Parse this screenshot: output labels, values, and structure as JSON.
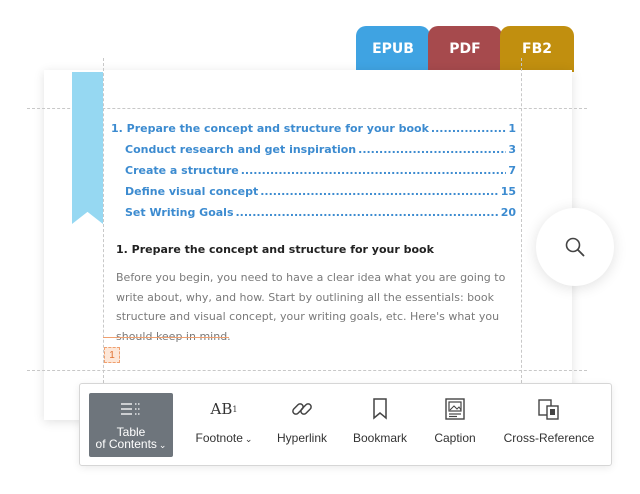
{
  "format_tabs": [
    {
      "label": "EPUB",
      "color": "#3fa3e2"
    },
    {
      "label": "PDF",
      "color": "#a64a4d"
    },
    {
      "label": "FB2",
      "color": "#c18f0f"
    }
  ],
  "toc": [
    {
      "label": "1. Prepare the concept and structure for your book",
      "page": "1",
      "level": 1
    },
    {
      "label": "Conduct research and get inspiration",
      "page": "3",
      "level": 2
    },
    {
      "label": "Create a structure",
      "page": "7",
      "level": 2
    },
    {
      "label": "Define visual concept",
      "page": "15",
      "level": 2
    },
    {
      "label": "Set Writing Goals",
      "page": "20",
      "level": 2
    }
  ],
  "section": {
    "heading": "1. Prepare the concept and structure for your book",
    "body": "Before you begin, you need to have a clear idea what you are going to write about, why, and how. Start by outlining all the essentials: book structure and visual concept, your writing goals, etc. Here's what you should keep in mind."
  },
  "footnote_marker": "1",
  "search": {
    "icon": "search-icon"
  },
  "toolbar": {
    "table_of_contents": {
      "line1": "Table",
      "line2": "of Contents",
      "icon": "toc-icon"
    },
    "footnote": {
      "label": "Footnote",
      "icon": "footnote-icon",
      "glyph": "AB",
      "sup": "1"
    },
    "hyperlink": {
      "label": "Hyperlink",
      "icon": "link-icon"
    },
    "bookmark": {
      "label": "Bookmark",
      "icon": "bookmark-icon"
    },
    "caption": {
      "label": "Caption",
      "icon": "image-caption-icon"
    },
    "cross_reference": {
      "label": "Cross-Reference",
      "icon": "cross-reference-icon"
    }
  }
}
